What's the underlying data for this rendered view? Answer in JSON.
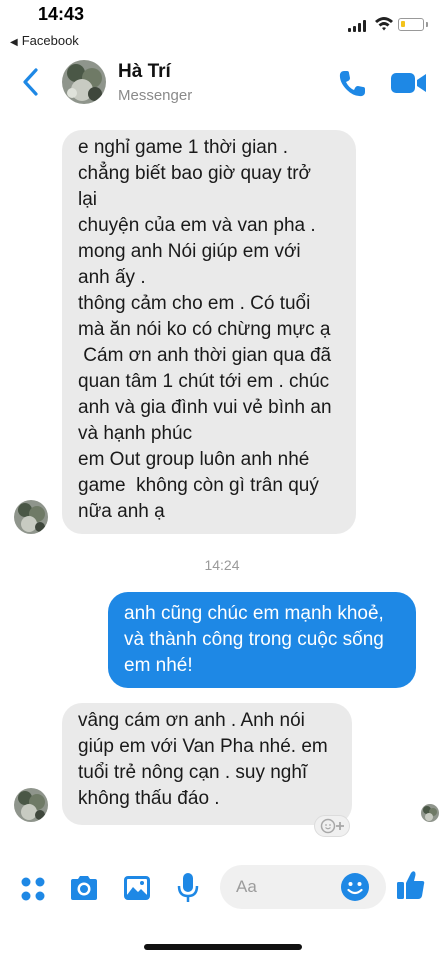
{
  "status_bar": {
    "time": "14:43",
    "back_app": "Facebook"
  },
  "header": {
    "name": "Hà Trí",
    "subtitle": "Messenger"
  },
  "colors": {
    "accent": "#1e88e5",
    "bubble_in": "#eaeaea",
    "bubble_out": "#1e88e5"
  },
  "messages": {
    "m1": [
      "e nghỉ game 1 thời gian .",
      "chẳng biết bao giờ quay trở",
      "lại",
      "chuyện của em và van pha .",
      "mong anh Nói giúp em với",
      "anh ấy .",
      "thông cảm cho em . Có tuổi",
      "mà ăn nói ko có chừng mực ạ",
      " Cám ơn anh thời gian qua đã",
      "quan tâm 1 chút tới em . chúc",
      "anh và gia đình vui vẻ bình an",
      "và hạnh phúc",
      "em Out group luôn anh nhé",
      "game  không còn gì trân quý",
      "nữa anh ạ"
    ],
    "timestamp": "14:24",
    "m2": [
      "anh cũng chúc em mạnh khoẻ,",
      "và thành công trong cuộc sống",
      "em nhé!"
    ],
    "m3": [
      "vâng cám ơn anh . Anh nói",
      "giúp em với Van Pha nhé. em",
      "tuổi trẻ nông cạn . suy nghĩ",
      "không thấu đáo ."
    ]
  },
  "composer": {
    "placeholder": "Aa"
  },
  "icons": {
    "menu": "four-dots-icon",
    "camera": "camera-icon",
    "gallery": "image-icon",
    "mic": "microphone-icon",
    "emoji": "emoji-icon",
    "like": "thumbs-up-icon",
    "call": "phone-icon",
    "video": "video-icon",
    "back": "chevron-left-icon"
  }
}
